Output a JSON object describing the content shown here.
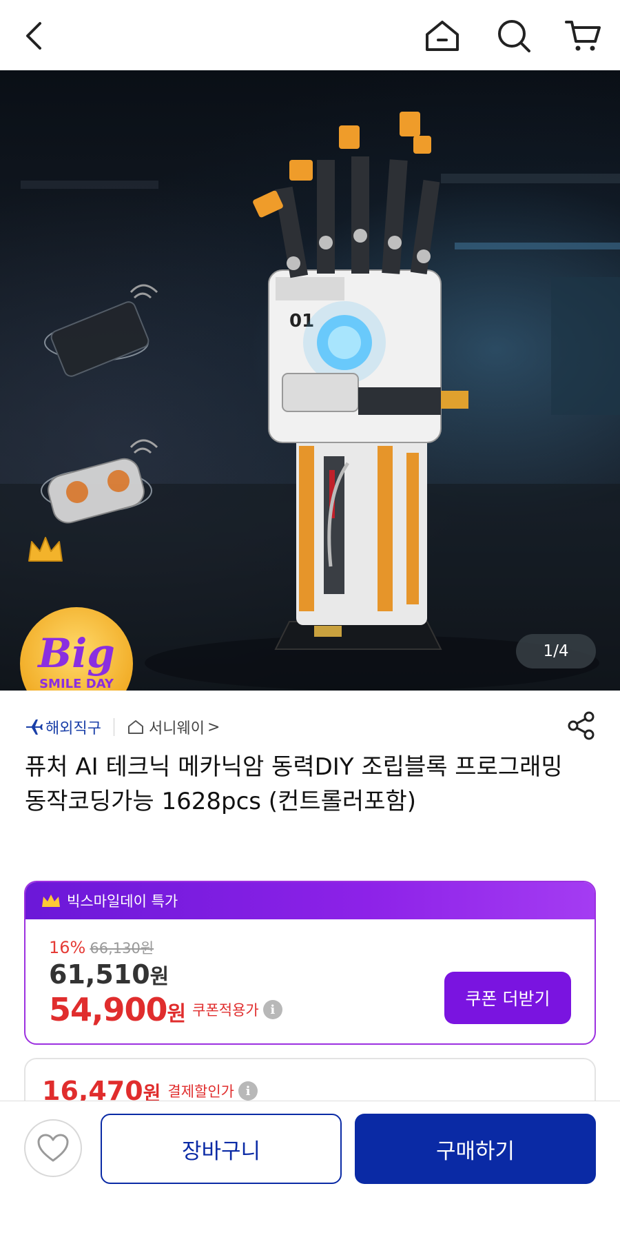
{
  "header": {
    "back_icon": "chevron-left-icon",
    "home_icon": "home-icon",
    "search_icon": "search-icon",
    "cart_icon": "cart-icon"
  },
  "hero": {
    "page_indicator": "1/4",
    "badge": {
      "big": "Big",
      "smile_day": "SMILE DAY"
    },
    "model_label": "01"
  },
  "product": {
    "shipping_type": "해외직구",
    "shop_name": "서니웨이",
    "shop_arrow": ">",
    "title": "퓨처 AI 테크닉 메카닉암 동력DIY 조립블록 프로그래밍 동작코딩가능 1628pcs (컨트롤러포함)"
  },
  "price_card": {
    "band_label": "빅스마일데이 특가",
    "discount": "16%",
    "original_price": "66,130원",
    "sale_price": "61,510",
    "sale_unit": "원",
    "coupon_price": "54,900",
    "coupon_unit": "원",
    "coupon_label": "쿠폰적용가",
    "coupon_button": "쿠폰 더받기",
    "accent_color": "#7a14e0"
  },
  "pay_card": {
    "pay_price": "16,470",
    "pay_unit": "원",
    "pay_label": "결제할인가"
  },
  "bottom_bar": {
    "wishlist_icon": "heart-icon",
    "cart_label": "장바구니",
    "buy_label": "구매하기",
    "brand_color": "#0a2aa5"
  }
}
